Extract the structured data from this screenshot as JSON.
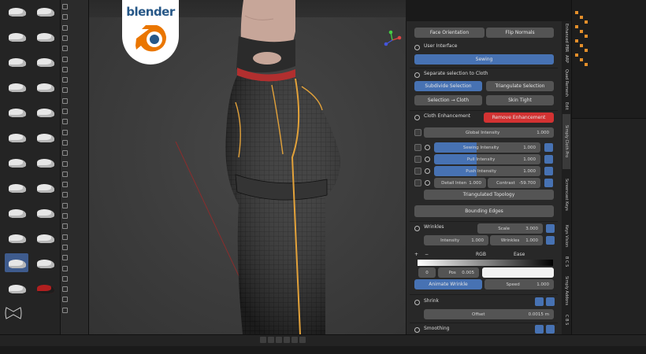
{
  "logo": {
    "wordmark": "blender"
  },
  "n_panel": {
    "face_orientation": "Face Orientation",
    "flip_normals": "Flip Normals",
    "user_interface": "User Interface",
    "sewing": "Sewing",
    "separate_selection": "Separate selection to Cloth",
    "subdivide_selection": "Subdivide Selection",
    "triangulate_selection": "Triangulate Selection",
    "selection_to_cloth": "Selection → Cloth",
    "skin_tight": "Skin Tight",
    "cloth_enhancement": "Cloth Enhancement",
    "remove_enhancement": "Remove Enhancement",
    "global_intensity": {
      "label": "Global Intensity",
      "value": "1.000"
    },
    "sewing_intensity": {
      "label": "Sewing Intensity",
      "value": "1.000"
    },
    "pull_intensity": {
      "label": "Pull Intensity",
      "value": "1.000"
    },
    "push_intensity": {
      "label": "Push Intensity",
      "value": "1.000"
    },
    "detail_inten": {
      "label": "Detail Inten",
      "value": "1.000"
    },
    "contrast": {
      "label": "Contrast",
      "value": "-59.700"
    },
    "triangulated_topology": "Triangulated Topology",
    "bounding_edges": "Bounding Edges",
    "wrinkles": "Wrinkles",
    "scale": {
      "label": "Scale",
      "value": "3.000"
    },
    "intensity": {
      "label": "Intensity",
      "value": "1.000"
    },
    "wrinkles_field": {
      "label": "Wrinkles",
      "value": "1.000"
    },
    "ramp_plus": "+",
    "ramp_minus": "−",
    "ramp_mode": "RGB",
    "ramp_interp": "Ease",
    "ramp_index": "0",
    "pos": {
      "label": "Pos",
      "value": "0.005"
    },
    "animate_wrinkle": "Animate Wrinkle",
    "speed": {
      "label": "Speed",
      "value": "1.000"
    },
    "shrink": "Shrink",
    "offset": {
      "label": "Offset",
      "value": "0.0015 m"
    },
    "smoothing": "Smoothing"
  },
  "side_tabs": [
    "Enhanced PBR",
    "ARP",
    "Quad Remesh",
    "Edit",
    "Simply Cloth Pro",
    "Screencast Keys",
    "Keys Vision",
    "B C S",
    "Simply Addons",
    "C B S"
  ],
  "colors": {
    "accent": "#4772b3",
    "danger": "#d33232",
    "seam": "#e3a23a"
  }
}
